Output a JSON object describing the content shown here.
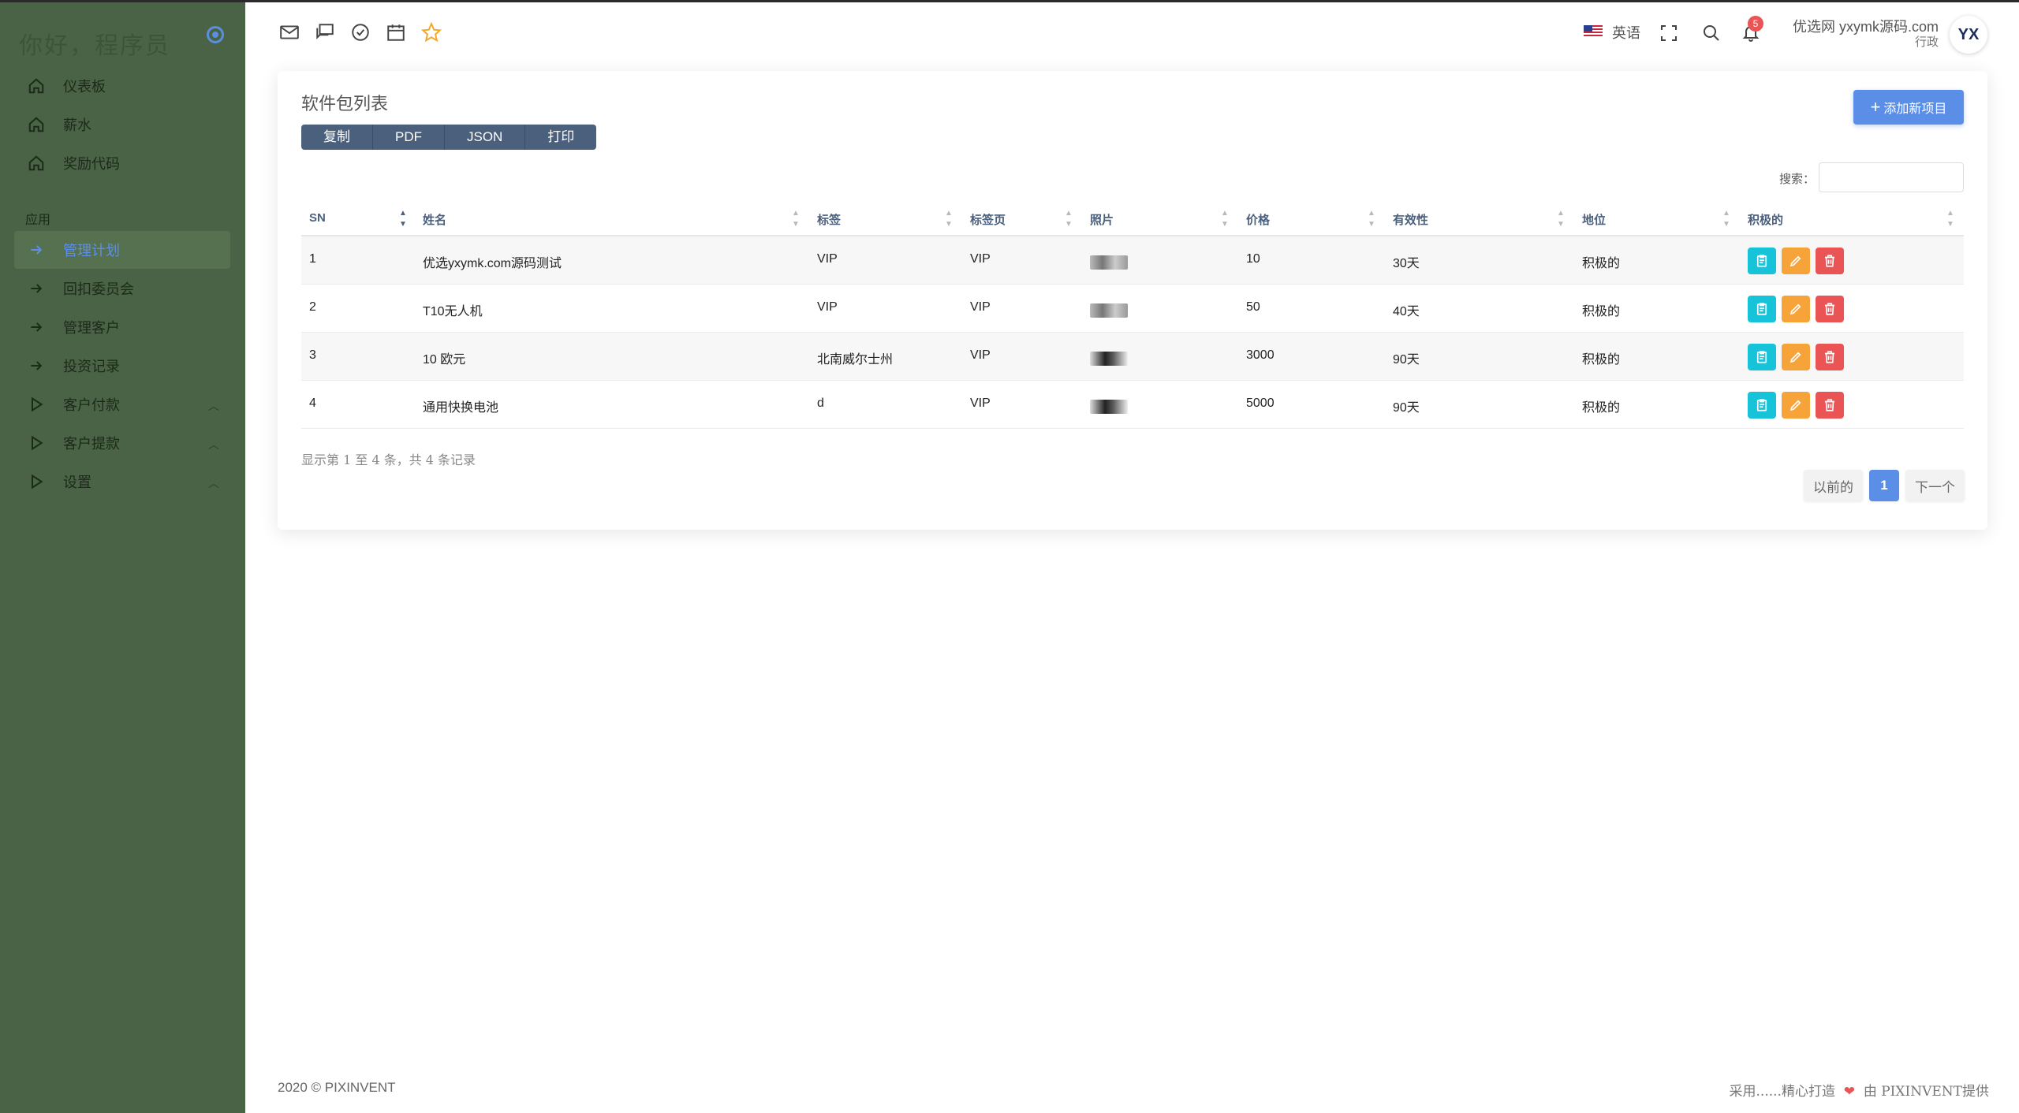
{
  "sidebar": {
    "brand": "你好，程序员",
    "items": [
      {
        "label": "仪表板",
        "icon": "home-icon"
      },
      {
        "label": "薪水",
        "icon": "home-icon"
      },
      {
        "label": "奖励代码",
        "icon": "home-icon"
      }
    ],
    "section_label": "应用",
    "app_items": [
      {
        "label": "管理计划",
        "icon": "arrow-right-icon",
        "active": true
      },
      {
        "label": "回扣委员会",
        "icon": "arrow-right-icon"
      },
      {
        "label": "管理客户",
        "icon": "arrow-right-icon"
      },
      {
        "label": "投资记录",
        "icon": "arrow-right-icon"
      },
      {
        "label": "客户付款",
        "icon": "play-icon",
        "expandable": true
      },
      {
        "label": "客户提款",
        "icon": "play-icon",
        "expandable": true
      },
      {
        "label": "设置",
        "icon": "play-icon",
        "expandable": true
      }
    ]
  },
  "header": {
    "icons": [
      "mail-icon",
      "chat-icon",
      "check-circle-icon",
      "calendar-icon",
      "star-icon"
    ],
    "language": "英语",
    "notification_count": "5",
    "user_name": "优选网 yxymk源码.com",
    "user_role": "行政",
    "avatar_text": "YX"
  },
  "card": {
    "title": "软件包列表",
    "export_buttons": [
      "复制",
      "PDF",
      "JSON",
      "打印"
    ],
    "add_button": "添加新项目",
    "search_label": "搜索：",
    "search_value": "",
    "columns": [
      "SN",
      "姓名",
      "标签",
      "标签页",
      "照片",
      "价格",
      "有效性",
      "地位",
      "积极的"
    ],
    "rows": [
      {
        "sn": "1",
        "name": "优选yxymk.com源码测试",
        "tag": "VIP",
        "tab": "VIP",
        "price": "10",
        "validity": "30天",
        "status": "积极的"
      },
      {
        "sn": "2",
        "name": "T10无人机",
        "tag": "VIP",
        "tab": "VIP",
        "price": "50",
        "validity": "40天",
        "status": "积极的"
      },
      {
        "sn": "3",
        "name": "10 欧元",
        "tag": "北南威尔士州",
        "tab": "VIP",
        "price": "3000",
        "validity": "90天",
        "status": "积极的"
      },
      {
        "sn": "4",
        "name": "通用快换电池",
        "tag": "d",
        "tab": "VIP",
        "price": "5000",
        "validity": "90天",
        "status": "积极的"
      }
    ],
    "info": "显示第 1 至 4 条，共 4 条记录",
    "pager": {
      "prev": "以前的",
      "current": "1",
      "next": "下一个"
    }
  },
  "footer": {
    "left": "2020 © PIXINVENT",
    "right_prefix": "采用......精心打造",
    "right_suffix": "由 PIXINVENT提供"
  },
  "colors": {
    "sidebar_bg": "#4a6245",
    "accent": "#5b8ee6",
    "view": "#17c3d8",
    "edit": "#f6a43a",
    "delete": "#ea5455"
  }
}
